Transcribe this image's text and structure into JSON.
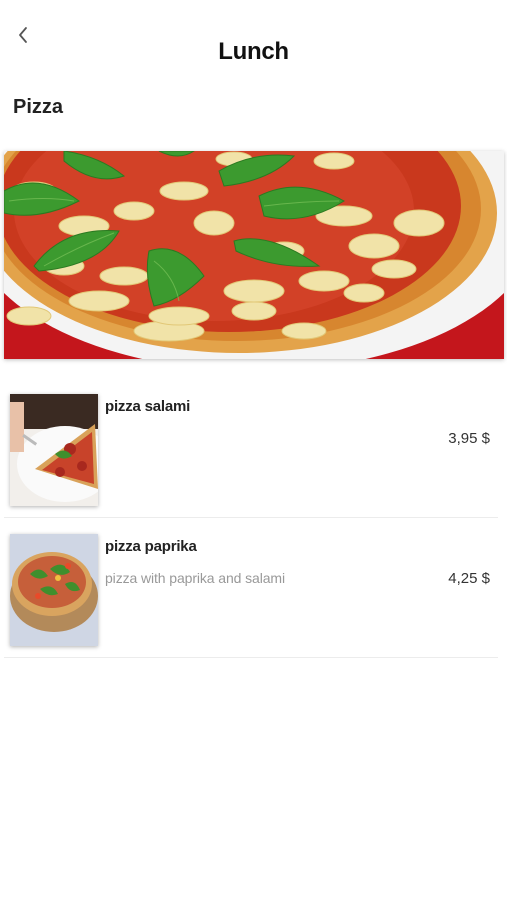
{
  "header": {
    "title": "Lunch",
    "back_icon": "chevron-left-icon"
  },
  "section": {
    "title": "Pizza"
  },
  "hero": {
    "image": "margherita-pizza-photo"
  },
  "items": [
    {
      "name": "pizza salami",
      "description": "",
      "price": "3,95 $",
      "image": "pizza-salami-photo"
    },
    {
      "name": "pizza paprika",
      "description": "pizza with paprika and salami",
      "price": "4,25 $",
      "image": "pizza-paprika-photo"
    }
  ]
}
